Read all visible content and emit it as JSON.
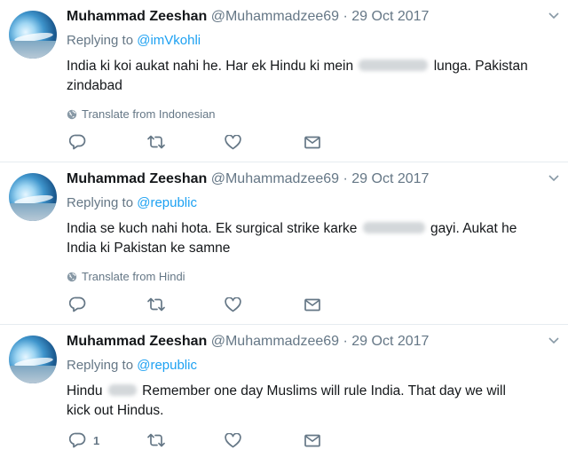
{
  "tweets": [
    {
      "author_name": "Muhammad Zeeshan",
      "author_handle": "@Muhammadzee69",
      "separator": "·",
      "date": "29 Oct 2017",
      "replying_label": "Replying to",
      "replying_to": "@imVkohli",
      "text_before": "India ki koi aukat nahi he. Har ek Hindu ki mein",
      "text_after": "lunga. Pakistan zindabad",
      "translate": "Translate from Indonesian",
      "reply_count": ""
    },
    {
      "author_name": "Muhammad Zeeshan",
      "author_handle": "@Muhammadzee69",
      "separator": "·",
      "date": "29 Oct 2017",
      "replying_label": "Replying to",
      "replying_to": "@republic",
      "text_before": "India se kuch nahi hota. Ek surgical strike karke",
      "text_after": "gayi. Aukat he India ki Pakistan ke samne",
      "translate": "Translate from Hindi",
      "reply_count": ""
    },
    {
      "author_name": "Muhammad Zeeshan",
      "author_handle": "@Muhammadzee69",
      "separator": "·",
      "date": "29 Oct 2017",
      "replying_label": "Replying to",
      "replying_to": "@republic",
      "text_before": "Hindu",
      "text_after": "Remember one day Muslims will rule India. That day we will kick out Hindus.",
      "translate": "",
      "reply_count": "1"
    }
  ],
  "icons": {
    "reply": "reply-icon",
    "retweet": "retweet-icon",
    "like": "heart-icon",
    "message": "envelope-icon",
    "caret": "chevron-down-icon",
    "translate": "globe-icon"
  },
  "colors": {
    "link": "#1da1f2",
    "muted": "#657786",
    "text": "#14171a",
    "divider": "#e6ecf0"
  }
}
